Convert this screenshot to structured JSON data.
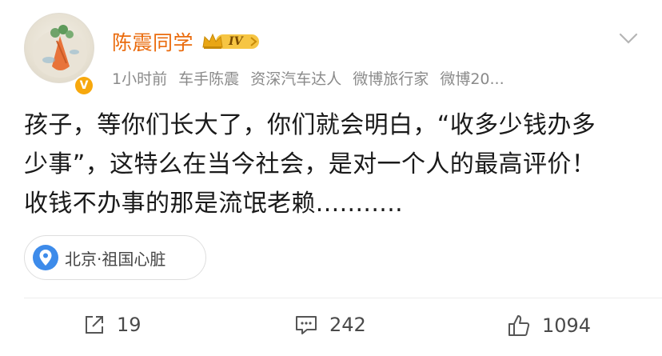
{
  "post": {
    "author": "陈震同学",
    "level_badge": "IV",
    "meta": [
      "1小时前",
      "车手陈震",
      "资深汽车达人",
      "微博旅行家",
      "微博20..."
    ],
    "text_lines": [
      "孩子，等你们长大了，你们就会明白，“收多少钱办多",
      "少事”，这特么在当今社会，是对一个人的最高评价！",
      "收钱不办事的那是流氓老赖..........."
    ],
    "location": "北京·祖国心脏"
  },
  "actions": {
    "repost_count": "19",
    "comment_count": "242",
    "like_count": "1094"
  },
  "colors": {
    "username": "#ea6b0d",
    "verified": "#f7a80d",
    "location_pin": "#3d8bea",
    "meta": "#8a8a8a"
  },
  "icons": [
    "verified-badge-icon",
    "level-crown-icon",
    "chevron-down-icon",
    "location-pin-icon",
    "repost-icon",
    "comment-icon",
    "like-icon"
  ]
}
